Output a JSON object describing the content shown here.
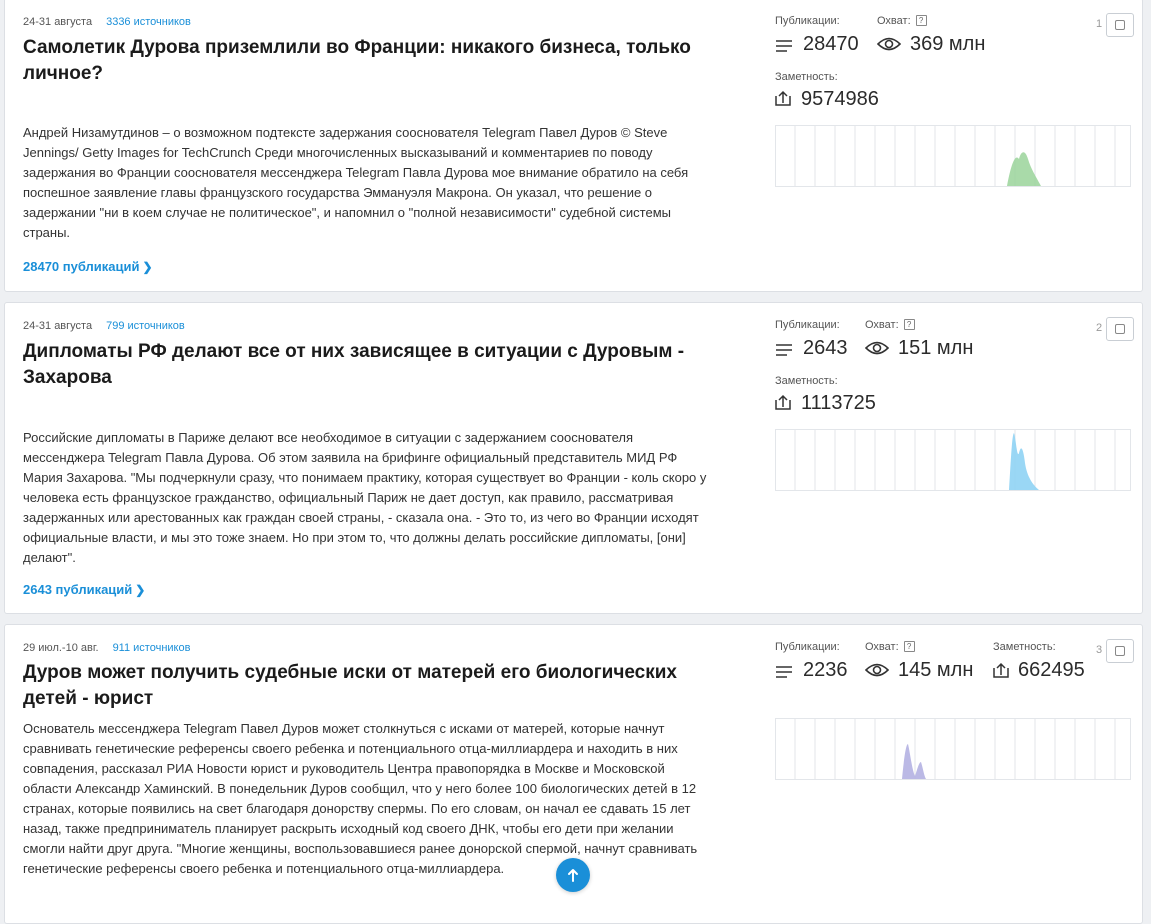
{
  "labels": {
    "publications": "Публикации:",
    "reach": "Охват:",
    "prominence": "Заметность:",
    "help": "?"
  },
  "icons": {
    "publications": "lines-icon",
    "reach": "eye-icon",
    "prominence": "prominence-icon",
    "scroll": "arrow-up-icon"
  },
  "colors": {
    "accent": "#1a8fd8",
    "chart_green": "#9ad39a",
    "chart_blue": "#8fd3f4",
    "chart_purple": "#b7b5e4"
  },
  "stories": [
    {
      "number": "1",
      "date": "24-31 августа",
      "sources": "3336 источников",
      "title": "Самолетик Дурова приземлили во Франции: никакого бизнеса, только личное?",
      "text": "Андрей Низамутдинов – о возможном подтексте задержания сооснователя Telegram Павел Дуров © Steve Jennings/ Getty Images for TechCrunch Среди многочисленных высказываний и комментариев по поводу задержания во Франции сооснователя мессенджера Telegram Павла Дурова мое внимание обратило на себя поспешное заявление главы французского государства Эммануэля Макрона. Он указал, что решение о задержании \"ни в коем случае не политическое\", и напомнил о \"полной независимости\" судебной системы страны.",
      "publications": "28470",
      "reach": "369 млн",
      "prominence": "9574986",
      "link": "28470 публикаций"
    },
    {
      "number": "2",
      "date": "24-31 августа",
      "sources": "799 источников",
      "title": "Дипломаты РФ делают все от них зависящее в ситуации с Дуровым - Захарова",
      "text": "Российские дипломаты в Париже делают все необходимое в ситуации с задержанием сооснователя мессенджера Telegram Павла Дурова. Об этом заявила на брифинге официальный представитель МИД РФ Мария Захарова. \"Мы подчеркнули сразу, что понимаем практику, которая существует во Франции - коль скоро у человека есть французское гражданство, официальный Париж не дает доступ, как правило, рассматривая задержанных или арестованных как граждан своей страны, - сказала она. - Это то, из чего во Франции исходят официальные власти, и мы это тоже знаем. Но при этом то, что должны делать российские дипломаты, [они] делают\".",
      "publications": "2643",
      "reach": "151 млн",
      "prominence": "1113725",
      "link": "2643 публикаций"
    },
    {
      "number": "3",
      "date": "29 июл.-10 авг.",
      "sources": "911 источников",
      "title": "Дуров может получить судебные иски от матерей его биологических детей - юрист",
      "text": "Основатель мессенджера Telegram Павел Дуров может столкнуться с исками от матерей, которые начнут сравнивать генетические референсы своего ребенка и потенциального отца-миллиардера и находить в них совпадения, рассказал РИА Новости юрист и руководитель Центра правопорядка в Москве и Московской области Александр Хаминский. В понедельник Дуров сообщил, что у него более 100 биологических детей в 12 странах, которые появились на свет благодаря донорству спермы. По его словам, он начал ее сдавать 15 лет назад, также предприниматель планирует раскрыть исходный код своего ДНК, чтобы его дети при желании смогли найти друг друга. \"Многие женщины, воспользовавшиеся ранее донорской спермой, начнут сравнивать генетические референсы своего ребенка и потенциального отца-миллиардера.",
      "publications": "2236",
      "reach": "145 млн",
      "prominence": "662495"
    }
  ]
}
